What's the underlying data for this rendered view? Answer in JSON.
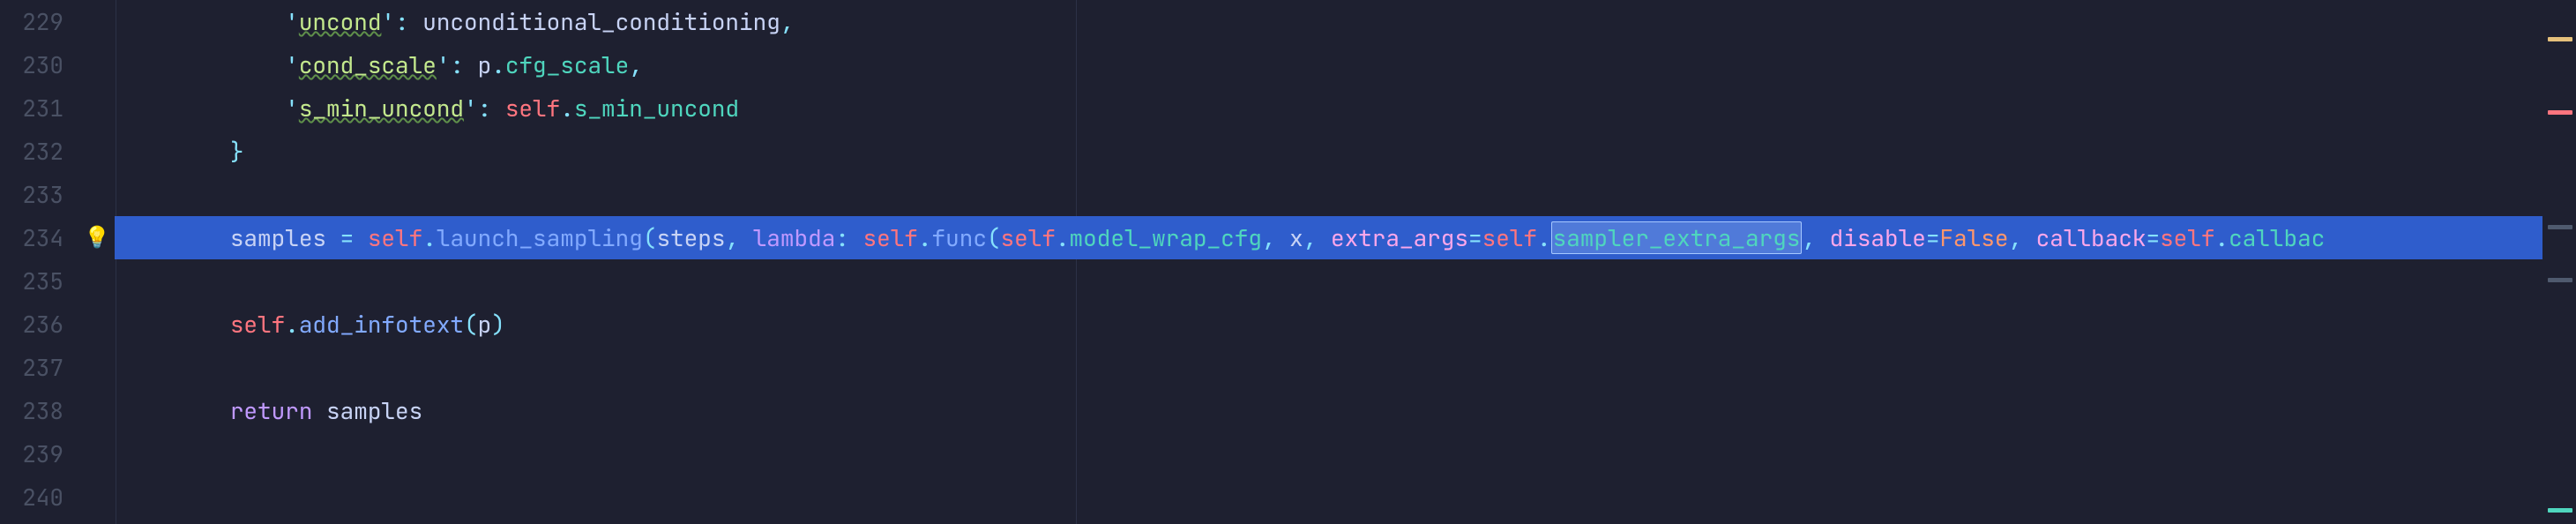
{
  "colors": {
    "background": "#1e2030",
    "highlight_line": "#2f5dcc",
    "gutter_text": "#4a5164",
    "default_text": "#c8d3f5",
    "punctuation": "#86e1fc",
    "string": "#c3e88d",
    "self": "#ff757f",
    "property": "#4fd6be",
    "keyword": "#c099ff",
    "method": "#82aaff",
    "parameter": "#fca7ea",
    "constant": "#ff966c",
    "indent_guide": "#2c3147"
  },
  "gutter": {
    "line_numbers": [
      "229",
      "230",
      "231",
      "232",
      "233",
      "234",
      "235",
      "236",
      "237",
      "238",
      "239",
      "240"
    ]
  },
  "icons": {
    "bulb_row_index": 5,
    "bulb_glyph": "💡"
  },
  "highlight_row_index": 5,
  "selection_box_text": "sampler_extra_args",
  "ruler_col_approx": 120,
  "minimap": {
    "marks": [
      {
        "top_pct": 7,
        "color": "#e5c07b"
      },
      {
        "top_pct": 21,
        "color": "#ff757f"
      },
      {
        "top_pct": 43,
        "color": "#4f5a6e"
      },
      {
        "top_pct": 53,
        "color": "#4f5a6e"
      },
      {
        "top_pct": 97,
        "color": "#4fd6be"
      }
    ]
  },
  "code": {
    "lines": [
      {
        "indent": "            ",
        "tokens": [
          {
            "cls": "punc",
            "t": "'"
          },
          {
            "cls": "squig",
            "t": "uncond"
          },
          {
            "cls": "punc",
            "t": "'"
          },
          {
            "cls": "punc",
            "t": ": "
          },
          {
            "cls": "ident",
            "t": "unconditional_conditioning"
          },
          {
            "cls": "punc",
            "t": ","
          }
        ]
      },
      {
        "indent": "            ",
        "tokens": [
          {
            "cls": "punc",
            "t": "'"
          },
          {
            "cls": "squig",
            "t": "cond_scale"
          },
          {
            "cls": "punc",
            "t": "'"
          },
          {
            "cls": "punc",
            "t": ": "
          },
          {
            "cls": "ident",
            "t": "p"
          },
          {
            "cls": "punc",
            "t": "."
          },
          {
            "cls": "prop",
            "t": "cfg_scale"
          },
          {
            "cls": "punc",
            "t": ","
          }
        ]
      },
      {
        "indent": "            ",
        "tokens": [
          {
            "cls": "punc",
            "t": "'"
          },
          {
            "cls": "squig",
            "t": "s_min_uncond"
          },
          {
            "cls": "punc",
            "t": "'"
          },
          {
            "cls": "punc",
            "t": ": "
          },
          {
            "cls": "self",
            "t": "self"
          },
          {
            "cls": "punc",
            "t": "."
          },
          {
            "cls": "prop",
            "t": "s_min_uncond"
          }
        ]
      },
      {
        "indent": "        ",
        "tokens": [
          {
            "cls": "punc",
            "t": "}"
          }
        ]
      },
      {
        "indent": "",
        "tokens": []
      },
      {
        "indent": "        ",
        "tokens": [
          {
            "cls": "ident",
            "t": "samples "
          },
          {
            "cls": "punc",
            "t": "= "
          },
          {
            "cls": "self",
            "t": "self"
          },
          {
            "cls": "punc",
            "t": "."
          },
          {
            "cls": "meth",
            "t": "launch_sampling"
          },
          {
            "cls": "punc",
            "t": "("
          },
          {
            "cls": "ident",
            "t": "steps"
          },
          {
            "cls": "punc",
            "t": ", "
          },
          {
            "cls": "kw",
            "t": "lambda"
          },
          {
            "cls": "punc",
            "t": ": "
          },
          {
            "cls": "self",
            "t": "self"
          },
          {
            "cls": "punc",
            "t": "."
          },
          {
            "cls": "meth",
            "t": "func"
          },
          {
            "cls": "punc",
            "t": "("
          },
          {
            "cls": "self",
            "t": "self"
          },
          {
            "cls": "punc",
            "t": "."
          },
          {
            "cls": "prop",
            "t": "model_wrap_cfg"
          },
          {
            "cls": "punc",
            "t": ", "
          },
          {
            "cls": "ident",
            "t": "x"
          },
          {
            "cls": "punc",
            "t": ", "
          },
          {
            "cls": "param",
            "t": "extra_args"
          },
          {
            "cls": "punc",
            "t": "="
          },
          {
            "cls": "self",
            "t": "self"
          },
          {
            "cls": "punc",
            "t": "."
          },
          {
            "cls": "prop boxsel",
            "t": "sampler_extra_args"
          },
          {
            "cls": "punc",
            "t": ", "
          },
          {
            "cls": "param",
            "t": "disable"
          },
          {
            "cls": "punc",
            "t": "="
          },
          {
            "cls": "const",
            "t": "False"
          },
          {
            "cls": "punc",
            "t": ", "
          },
          {
            "cls": "param",
            "t": "callback"
          },
          {
            "cls": "punc",
            "t": "="
          },
          {
            "cls": "self",
            "t": "self"
          },
          {
            "cls": "punc",
            "t": "."
          },
          {
            "cls": "prop",
            "t": "callbac"
          }
        ]
      },
      {
        "indent": "",
        "tokens": []
      },
      {
        "indent": "        ",
        "tokens": [
          {
            "cls": "self",
            "t": "self"
          },
          {
            "cls": "punc",
            "t": "."
          },
          {
            "cls": "meth",
            "t": "add_infotext"
          },
          {
            "cls": "punc",
            "t": "("
          },
          {
            "cls": "ident",
            "t": "p"
          },
          {
            "cls": "punc",
            "t": ")"
          }
        ]
      },
      {
        "indent": "",
        "tokens": []
      },
      {
        "indent": "        ",
        "tokens": [
          {
            "cls": "kw",
            "t": "return"
          },
          {
            "cls": "ident",
            "t": " samples"
          }
        ]
      },
      {
        "indent": "",
        "tokens": []
      },
      {
        "indent": "",
        "tokens": []
      }
    ]
  }
}
